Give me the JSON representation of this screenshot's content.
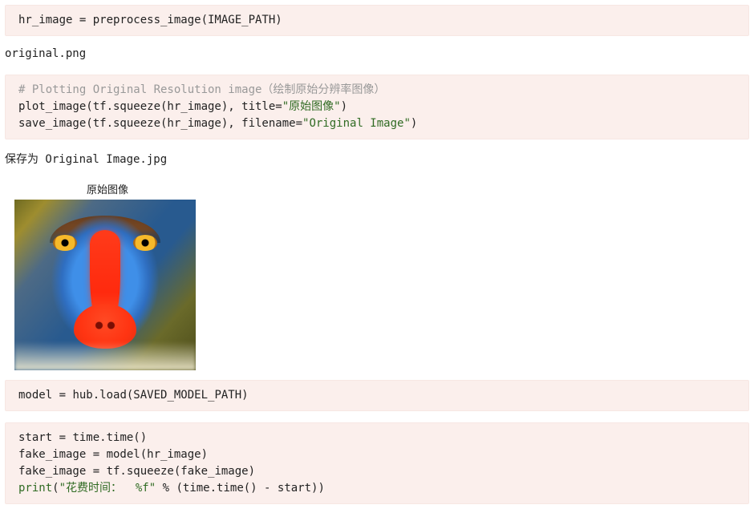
{
  "cells": {
    "c1": {
      "line1": {
        "a": "hr_image ",
        "op": "= ",
        "fn": "preprocess_image(IMAGE_PATH)"
      }
    },
    "out1": "original.png",
    "c2": {
      "comment": "# Plotting Original Resolution image（绘制原始分辨率图像）",
      "l2a": "plot_image(tf.squeeze(hr_image), title",
      "l2op": "=",
      "l2str": "\"原始图像\"",
      "l2b": ")",
      "l3a": "save_image(tf.squeeze(hr_image), filename",
      "l3op": "=",
      "l3str": "\"Original Image\"",
      "l3b": ")"
    },
    "out2": "保存为 Original Image.jpg",
    "figure_title": "原始图像",
    "c3": {
      "a": "model ",
      "op": "= ",
      "b": "hub.load(SAVED_MODEL_PATH)"
    },
    "c4": {
      "l1a": "start ",
      "l1op": "= ",
      "l1b": "time.time()",
      "l2a": "fake_image ",
      "l2op": "= ",
      "l2b": "model(hr_image)",
      "l3a": "fake_image ",
      "l3op": "= ",
      "l3b": "tf.squeeze(fake_image)",
      "l4a": "print",
      "l4b": "(",
      "l4str": "\"花费时间：  %f\"",
      "l4c": " % (time.time() ",
      "l4d": "- ",
      "l4e": "start))"
    }
  }
}
